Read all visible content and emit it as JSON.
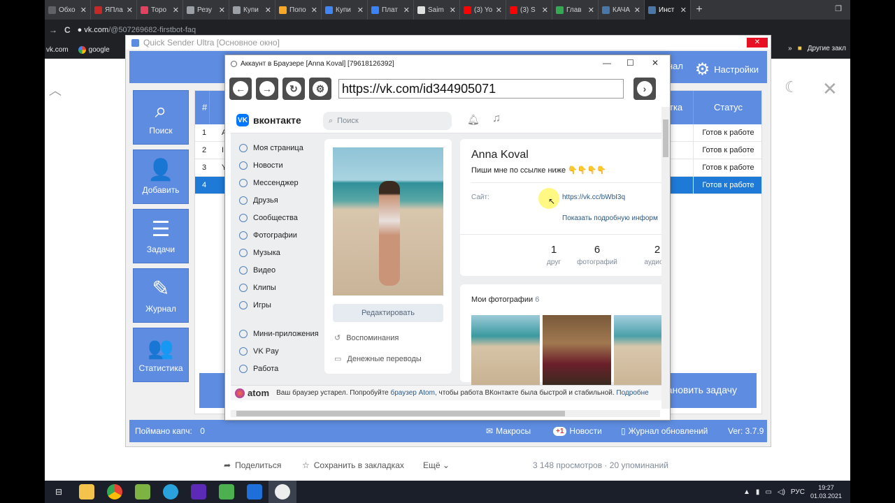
{
  "chrome": {
    "tabs": [
      {
        "label": "Обхо",
        "color": "#5f6368"
      },
      {
        "label": "ЯПла",
        "color": "#c62828"
      },
      {
        "label": "Торо",
        "color": "#e4405f"
      },
      {
        "label": "Резу",
        "color": "#9aa0a6"
      },
      {
        "label": "Купи",
        "color": "#9aa0a6"
      },
      {
        "label": "Попо",
        "color": "#f9a825"
      },
      {
        "label": "Купи",
        "color": "#4285f4"
      },
      {
        "label": "Плат",
        "color": "#3b82f6"
      },
      {
        "label": "Saim",
        "color": "#e0e0e0"
      },
      {
        "label": "(3) Yo",
        "color": "#ff0000"
      },
      {
        "label": "(3) S",
        "color": "#ff0000"
      },
      {
        "label": "Глав",
        "color": "#34a853"
      },
      {
        "label": "КАЧА",
        "color": "#4a76a8"
      },
      {
        "label": "Инст",
        "color": "#4a76a8"
      }
    ],
    "new_tab": "+",
    "address": {
      "host": "vk.com",
      "path": "/@507269682-firstbot-faq"
    },
    "bookmarks": {
      "left": [
        "vk.com",
        "google"
      ],
      "right_label": "Другие закл",
      "more": "»"
    },
    "icons": {
      "back": "→",
      "reload": "C",
      "lock": "🔒"
    }
  },
  "page": {
    "footer": {
      "share": "Поделиться",
      "save": "Сохранить в закладках",
      "more": "Ещё",
      "views": "3 148 просмотров",
      "mentions": "20 упоминаний"
    }
  },
  "taskbar": {
    "lang": "РУС",
    "time": "19:27",
    "date": "01.03.2021"
  },
  "qs": {
    "title": "Quick Sender Ultra [Основное окно]",
    "top": {
      "journal_tail": "нал",
      "settings": "Настройки"
    },
    "left_buttons": [
      {
        "label": "Поиск",
        "glyph": "⌕"
      },
      {
        "label": "Добавить",
        "glyph": "👤"
      },
      {
        "label": "Задачи",
        "glyph": "☰"
      },
      {
        "label": "Журнал",
        "glyph": "✎"
      },
      {
        "label": "Статистика",
        "glyph": "👥"
      }
    ],
    "table": {
      "num_header": "#",
      "status_header": "Статус",
      "head_tail": "тка",
      "rows": [
        {
          "num": "1",
          "snip": "А",
          "status": "Готов к работе",
          "selected": false
        },
        {
          "num": "2",
          "snip": "I",
          "status": "Готов к работе",
          "selected": false
        },
        {
          "num": "3",
          "snip": "Y",
          "status": "Готов к работе",
          "selected": false
        },
        {
          "num": "4",
          "snip": "",
          "status": "Готов к работе",
          "selected": true
        }
      ]
    },
    "big_button": "ановить задачу",
    "status_bar": {
      "captcha_label": "Поймано капч:",
      "captcha_value": "0",
      "macros": "Макросы",
      "news_badge": "+1",
      "news": "Новости",
      "updates": "Журнал обновлений",
      "version": "Ver: 3.7.9"
    }
  },
  "browser": {
    "title": "Аккаунт в Браузере [Anna Koval] [79618126392]",
    "url": "https://vk.com/id344905071",
    "vk": {
      "logo": "вконтакте",
      "search_placeholder": "Поиск",
      "menu": [
        "Моя страница",
        "Новости",
        "Мессенджер",
        "Друзья",
        "Сообщества",
        "Фотографии",
        "Музыка",
        "Видео",
        "Клипы",
        "Игры",
        "Мини-приложения",
        "VK Pay",
        "Работа"
      ],
      "edit": "Редактировать",
      "memories": "Воспоминания",
      "transfers": "Денежные переводы",
      "name": "Anna Koval",
      "status": "Пиши мне по ссылке ниже",
      "status_emoji": "👇👇👇👇",
      "site_label": "Сайт:",
      "site_url": "https://vk.cc/bWbI3q",
      "more_info": "Показать подробную информ",
      "counts": [
        {
          "n": "1",
          "label": "друг"
        },
        {
          "n": "6",
          "label": "фотографий"
        },
        {
          "n": "2",
          "label": "аудиоза"
        }
      ],
      "photos_title": "Мои фотографии",
      "photos_count": "6"
    },
    "atom": {
      "logo": "atom",
      "text": "Ваш браузер устарел. Попробуйте",
      "link": "браузер Atom,",
      "text2": "чтобы работа ВКонтакте была быстрой и стабильной.",
      "more": "Подробне"
    }
  }
}
